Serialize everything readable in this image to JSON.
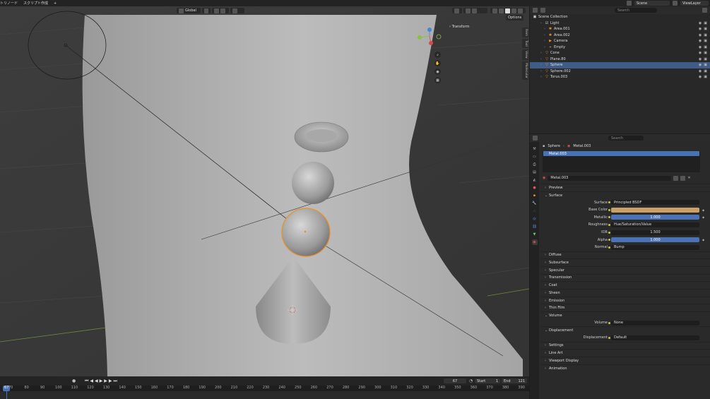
{
  "topbar": {
    "menus": [
      "トリノード",
      "スクリプト作成",
      "+"
    ],
    "scene_label": "Scene",
    "viewlayer_label": "ViewLayer"
  },
  "viewport": {
    "orientation": "Global",
    "transform_panel": "Transform",
    "options": "Options",
    "side_tabs": [
      "Item",
      "Tool",
      "View",
      "Molecular"
    ]
  },
  "timeline": {
    "current_frame": "67",
    "start_label": "Start",
    "start_value": "1",
    "end_label": "End",
    "end_value": "121",
    "frame_badge": "67",
    "ticks": [
      "70",
      "80",
      "90",
      "100",
      "110",
      "120",
      "130",
      "140",
      "150",
      "160",
      "170",
      "180",
      "190",
      "200",
      "210",
      "220",
      "230",
      "240",
      "250",
      "260",
      "270",
      "280",
      "290",
      "300",
      "310",
      "320",
      "330",
      "340",
      "350",
      "360",
      "370",
      "380",
      "390"
    ]
  },
  "outliner": {
    "search_placeholder": "Search",
    "root": "Scene Collection",
    "items": [
      {
        "label": "Light",
        "indent": 1,
        "icon": "collection",
        "selected": false
      },
      {
        "label": "Area.001",
        "indent": 2,
        "icon": "light",
        "selected": false
      },
      {
        "label": "Area.002",
        "indent": 2,
        "icon": "light",
        "selected": false
      },
      {
        "label": "Camera",
        "indent": 2,
        "icon": "camera",
        "selected": false
      },
      {
        "label": "Empty",
        "indent": 2,
        "icon": "empty",
        "selected": false
      },
      {
        "label": "Cone",
        "indent": 1,
        "icon": "mesh",
        "selected": false
      },
      {
        "label": "Plane.80",
        "indent": 1,
        "icon": "mesh",
        "selected": false
      },
      {
        "label": "Sphere",
        "indent": 1,
        "icon": "mesh",
        "selected": true
      },
      {
        "label": "Sphere.002",
        "indent": 1,
        "icon": "mesh",
        "selected": false
      },
      {
        "label": "Torus.003",
        "indent": 1,
        "icon": "mesh",
        "selected": false
      }
    ]
  },
  "properties": {
    "search_placeholder": "Search",
    "breadcrumb_object": "Sphere",
    "breadcrumb_material": "Metal.003",
    "slot_name": "Metal.003",
    "material_name": "Metal.003",
    "sections_top": [
      "Preview",
      "Surface"
    ],
    "surface_rows": [
      {
        "label": "Surface",
        "value": "Principled BSDF",
        "type": "field"
      },
      {
        "label": "Base Color",
        "value": "",
        "type": "color"
      },
      {
        "label": "Metallic",
        "value": "1.000",
        "type": "blue"
      },
      {
        "label": "Roughness",
        "value": "Hue/Saturation/Value",
        "type": "field"
      },
      {
        "label": "IOR",
        "value": "1.500",
        "type": "dark-center"
      },
      {
        "label": "Alpha",
        "value": "1.000",
        "type": "blue"
      },
      {
        "label": "Normal",
        "value": "Bump",
        "type": "field"
      }
    ],
    "sub_sections": [
      "Diffuse",
      "Subsurface",
      "Specular",
      "Transmission",
      "Coat",
      "Sheen",
      "Emission",
      "Thin Film"
    ],
    "volume_section": "Volume",
    "volume_label": "Volume",
    "volume_value": "None",
    "displacement_section": "Displacement",
    "displacement_label": "Displacement",
    "displacement_value": "Default",
    "bottom_sections": [
      "Settings",
      "Line Art",
      "Viewport Display",
      "Animation"
    ]
  },
  "colors": {
    "accent": "#4772b3",
    "selection_orange": "#e8912d",
    "base_color": "#c9a068"
  }
}
